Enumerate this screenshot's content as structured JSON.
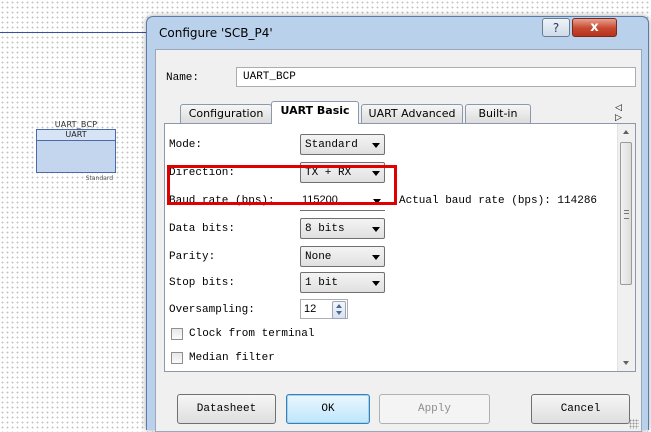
{
  "canvas": {
    "component": {
      "name": "UART_BCP",
      "type": "UART",
      "subtitle": "Standard"
    }
  },
  "dialog": {
    "title": "Configure 'SCB_P4'",
    "help_icon": "?",
    "close_icon": "x",
    "name_label": "Name:",
    "name_value": "UART_BCP",
    "tabs": [
      {
        "label": "Configuration",
        "active": false
      },
      {
        "label": "UART Basic",
        "active": true
      },
      {
        "label": "UART Advanced",
        "active": false
      },
      {
        "label": "Built-in",
        "active": false
      }
    ],
    "tab_scroll_icons": "◁ ▷",
    "fields": {
      "mode": {
        "label": "Mode:",
        "value": "Standard"
      },
      "direction": {
        "label": "Direction:",
        "value": "TX + RX"
      },
      "baud_rate": {
        "label": "Baud rate (bps):",
        "value": "115200",
        "actual": "Actual baud rate (bps): 114286"
      },
      "data_bits": {
        "label": "Data bits:",
        "value": "8 bits"
      },
      "parity": {
        "label": "Parity:",
        "value": "None"
      },
      "stop_bits": {
        "label": "Stop bits:",
        "value": "1 bit"
      },
      "oversampling": {
        "label": "Oversampling:",
        "value": "12"
      }
    },
    "checkboxes": [
      {
        "label": "Clock from terminal",
        "checked": false
      },
      {
        "label": "Median filter",
        "checked": false
      }
    ],
    "buttons": {
      "datasheet": "Datasheet",
      "ok": "OK",
      "apply": "Apply",
      "cancel": "Cancel"
    }
  },
  "highlight_color": "#e00000"
}
